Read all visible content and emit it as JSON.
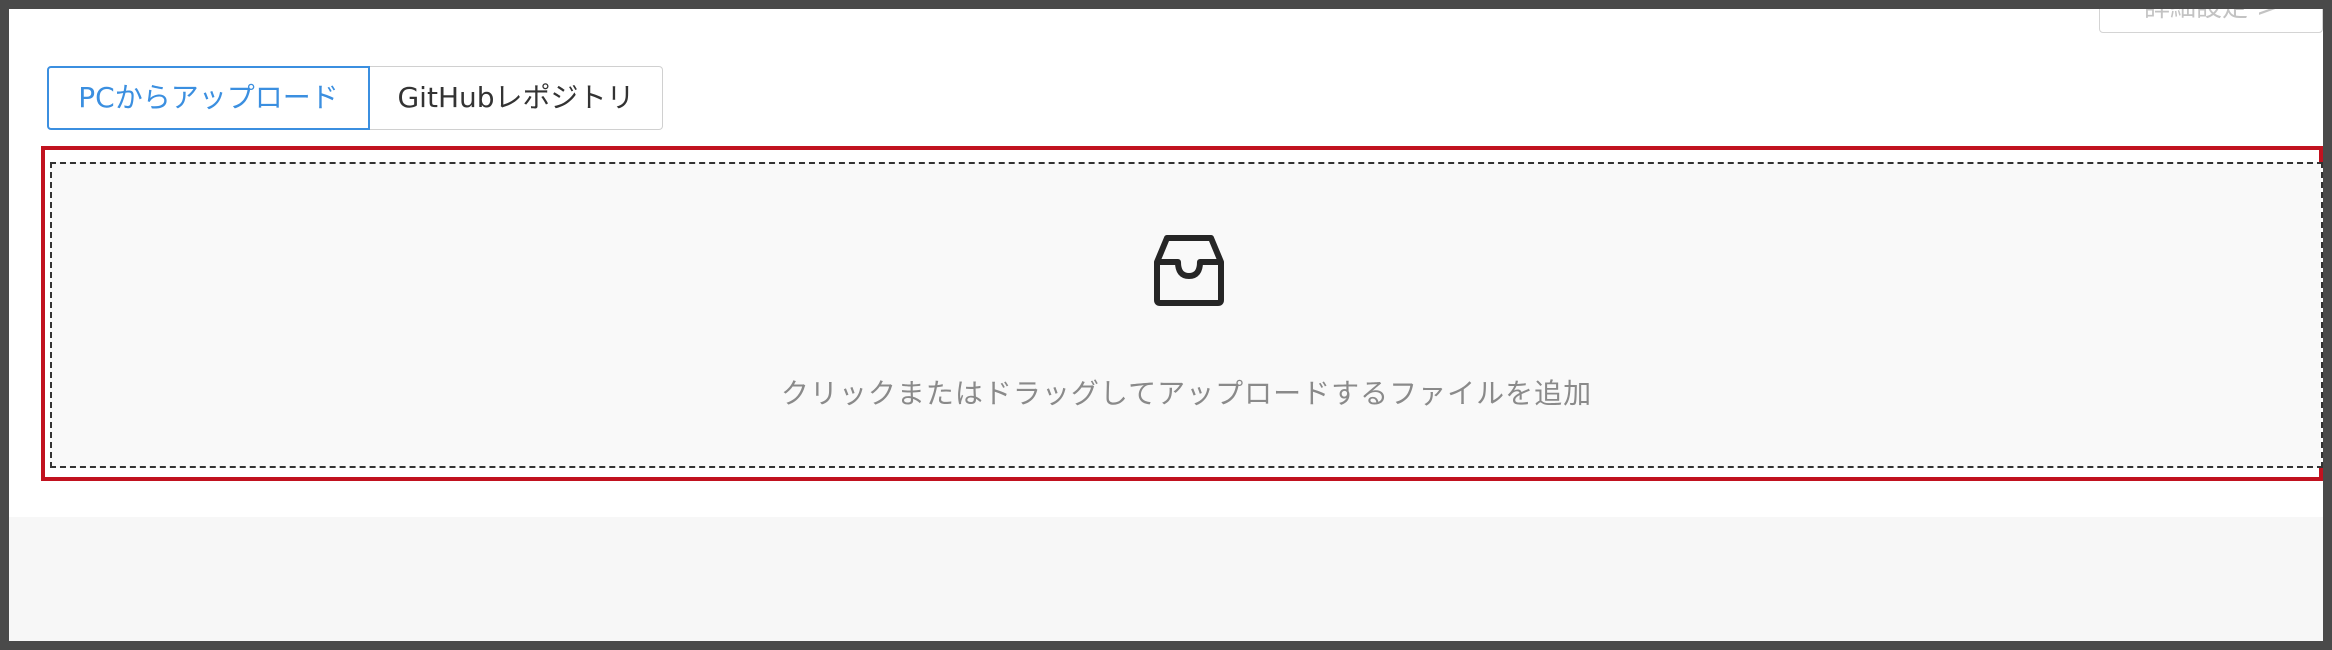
{
  "header": {
    "advanced_settings_label": "詳細設定 >"
  },
  "tabs": [
    {
      "label": "PCからアップロード",
      "active": true
    },
    {
      "label": "GitHubレポジトリ",
      "active": false
    }
  ],
  "dropzone": {
    "icon": "inbox-icon",
    "instruction": "クリックまたはドラッグしてアップロードするファイルを追加"
  },
  "colors": {
    "accent": "#3b8fe0",
    "highlight": "#c1121f",
    "text_muted": "#8a8a8a"
  }
}
